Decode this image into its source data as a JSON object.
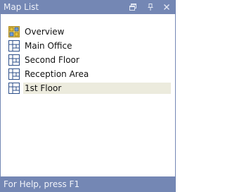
{
  "title_bar": {
    "title": "Map List",
    "buttons": [
      {
        "name": "float",
        "icon": "float-window-icon"
      },
      {
        "name": "pin",
        "icon": "pin-icon"
      },
      {
        "name": "close",
        "icon": "close-icon"
      }
    ]
  },
  "tree": {
    "items": [
      {
        "label": "Overview",
        "icon": "overview-map-icon",
        "selected": false
      },
      {
        "label": "Main Office",
        "icon": "floor-map-icon",
        "selected": false
      },
      {
        "label": "Second Floor",
        "icon": "floor-map-icon",
        "selected": false
      },
      {
        "label": "Reception Area",
        "icon": "floor-map-icon",
        "selected": false
      },
      {
        "label": "1st Floor",
        "icon": "floor-map-icon",
        "selected": true
      }
    ]
  },
  "status_bar": {
    "text": "For Help, press F1"
  },
  "colors": {
    "chrome": "#7487b4",
    "selection": "#ecebdd",
    "icon_blue": "#2d4f8a",
    "icon_yellow": "#e7c33a"
  }
}
